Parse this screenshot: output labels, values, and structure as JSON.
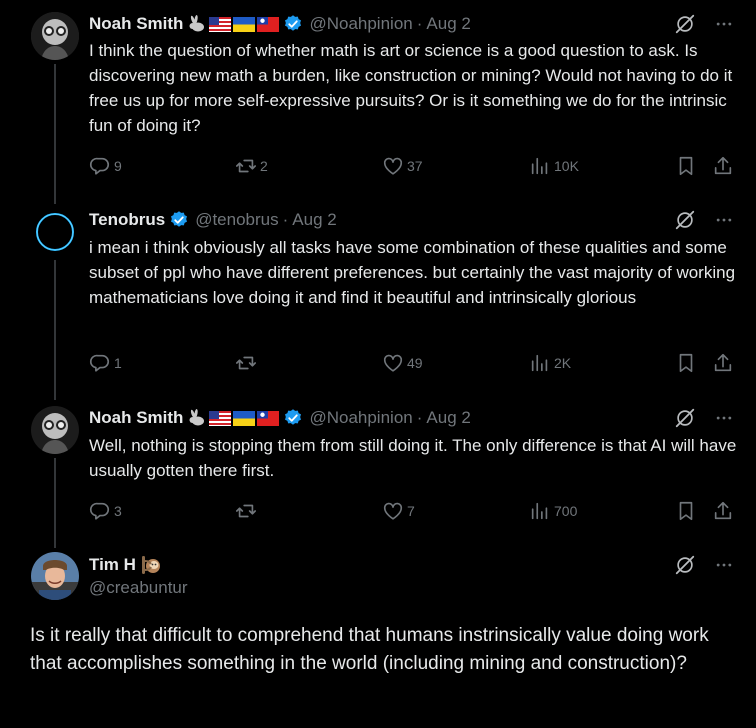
{
  "tweets": [
    {
      "name": "Noah Smith",
      "emojis": [
        "rabbit",
        "us-flag",
        "ukraine-flag",
        "taiwan-flag"
      ],
      "handle": "@Noahpinion",
      "date": "Aug 2",
      "text": "I think the question of whether math is art or science is a good question to ask. Is discovering new math a burden, like construction or mining? Would not having to do it free us up for more self-expressive pursuits? Or is it something we do for the intrinsic fun of doing it?",
      "replies": "9",
      "retweets": "2",
      "likes": "37",
      "views": "10K"
    },
    {
      "name": "Tenobrus",
      "handle": "@tenobrus",
      "date": "Aug 2",
      "text": "i mean i think obviously all tasks have some combination of these qualities and some subset of ppl who have different preferences. but certainly the vast majority of working mathematicians love doing it and find it beautiful and intrinsically glorious",
      "replies": "1",
      "retweets": "",
      "likes": "49",
      "views": "2K"
    },
    {
      "name": "Noah Smith",
      "handle": "@Noahpinion",
      "date": "Aug 2",
      "text": "Well, nothing is stopping them from still doing it. The only difference is that AI will have usually gotten there first.",
      "replies": "3",
      "retweets": "",
      "likes": "7",
      "views": "700"
    }
  ],
  "focus": {
    "name": "Tim H",
    "emoji": "sloth",
    "handle": "@creabuntur",
    "text": "Is it really that difficult to comprehend that humans instrinsically value doing work that accomplishes something in the world (including mining and construction)?"
  },
  "colors": {
    "background": "#000000",
    "text": "#e7e9ea",
    "muted": "#71767b",
    "verified": "#1d9bf0"
  }
}
